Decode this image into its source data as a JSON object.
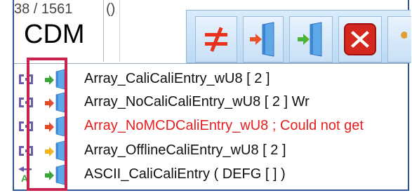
{
  "header": {
    "counter": "38 / 1561",
    "paren": "()",
    "title": "CDM"
  },
  "toolbar": {
    "buttons": [
      {
        "name": "not-equal",
        "icon": "not-equal-icon"
      },
      {
        "name": "import-left",
        "icon": "import-door-icon"
      },
      {
        "name": "import-right",
        "icon": "export-door-icon"
      },
      {
        "name": "delete",
        "icon": "red-x-icon"
      },
      {
        "name": "more",
        "icon": "partial-icon"
      }
    ]
  },
  "rows": [
    {
      "label": "Array_CaliCaliEntry_wU8 [ 2 ]",
      "arrow_color": "#3aa63a",
      "error": false
    },
    {
      "label": "Array_NoCaliCaliEntry_wU8 [ 2 ] Wr",
      "arrow_color": "#e2482a",
      "error": false
    },
    {
      "label": "Array_NoMCDCaliEntry_wU8 ; Could not get",
      "arrow_color": "#e2482a",
      "error": true
    },
    {
      "label": "Array_OfflineCaliEntry_wU8 [ 2 ]",
      "arrow_color": "#f2b51c",
      "error": false
    },
    {
      "label": "ASCII_CaliCaliEntry ( DEFG [  ]  )",
      "arrow_color": "#3aa63a",
      "error": false
    }
  ],
  "colors": {
    "error_text": "#e52020",
    "highlight_box": "#c8224f",
    "toolbar_bg": "#cfe4f7"
  }
}
